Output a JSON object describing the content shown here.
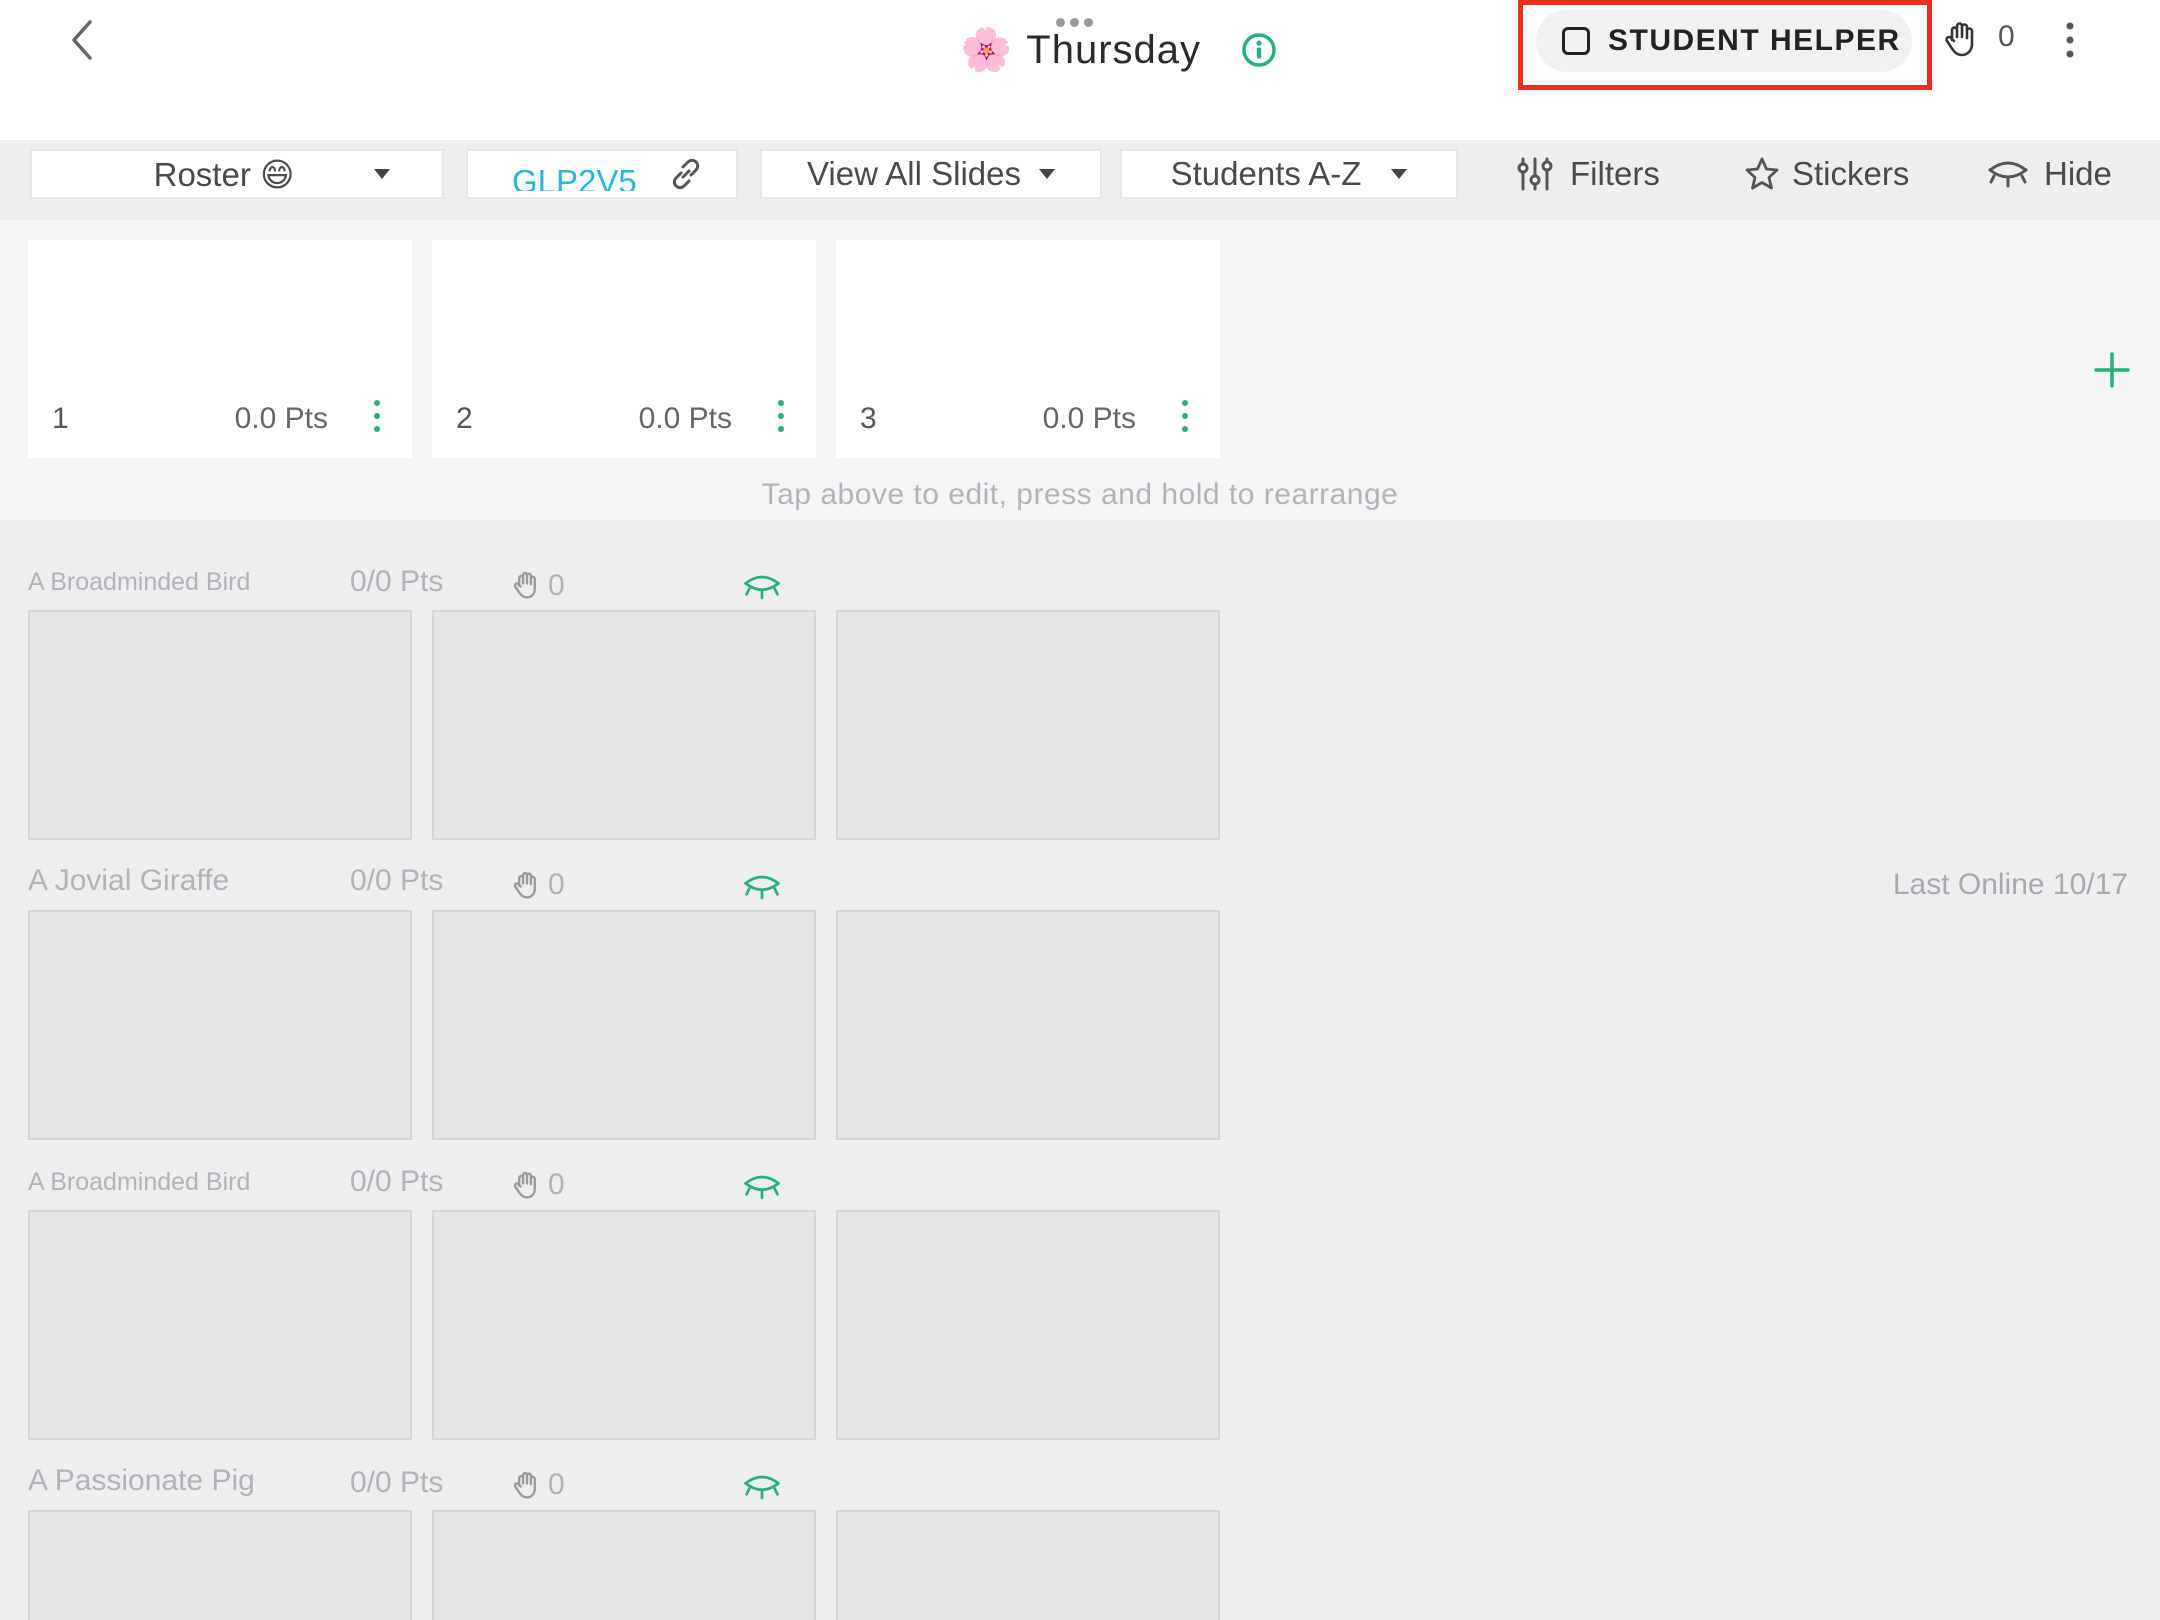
{
  "header": {
    "title": "Thursday",
    "title_emoji": "🌸",
    "student_helper_label": "STUDENT HELPER",
    "raised_hands_count": "0"
  },
  "toolbar": {
    "roster_label": "Roster 😄",
    "class_code": "GLP2V5",
    "view_label": "View All Slides",
    "sort_label": "Students A-Z",
    "filters_label": "Filters",
    "stickers_label": "Stickers",
    "hide_label": "Hide"
  },
  "slides": [
    {
      "number": "1",
      "points": "0.0 Pts"
    },
    {
      "number": "2",
      "points": "0.0 Pts"
    },
    {
      "number": "3",
      "points": "0.0 Pts"
    }
  ],
  "hint": "Tap above to edit, press and hold to rearrange",
  "students": [
    {
      "name": "A Broadminded Bird",
      "points": "0/0 Pts",
      "hands": "0",
      "last_online": ""
    },
    {
      "name": "A Jovial Giraffe",
      "points": "0/0 Pts",
      "hands": "0",
      "last_online": "Last Online 10/17"
    },
    {
      "name": "A Broadminded Bird",
      "points": "0/0 Pts",
      "hands": "0",
      "last_online": ""
    },
    {
      "name": "A Passionate Pig",
      "points": "0/0 Pts",
      "hands": "0",
      "last_online": ""
    }
  ],
  "colors": {
    "accent_green": "#28b07a",
    "highlight_red": "#e8321f",
    "class_code_blue": "#2bb6d9"
  },
  "icons": {
    "back": "chevron-left-icon",
    "info": "info-icon",
    "hand": "raised-hand-icon",
    "more": "more-vertical-icon",
    "link": "link-icon",
    "filters": "sliders-icon",
    "stickers": "star-icon",
    "hide": "closed-eye-icon",
    "add": "plus-icon"
  }
}
